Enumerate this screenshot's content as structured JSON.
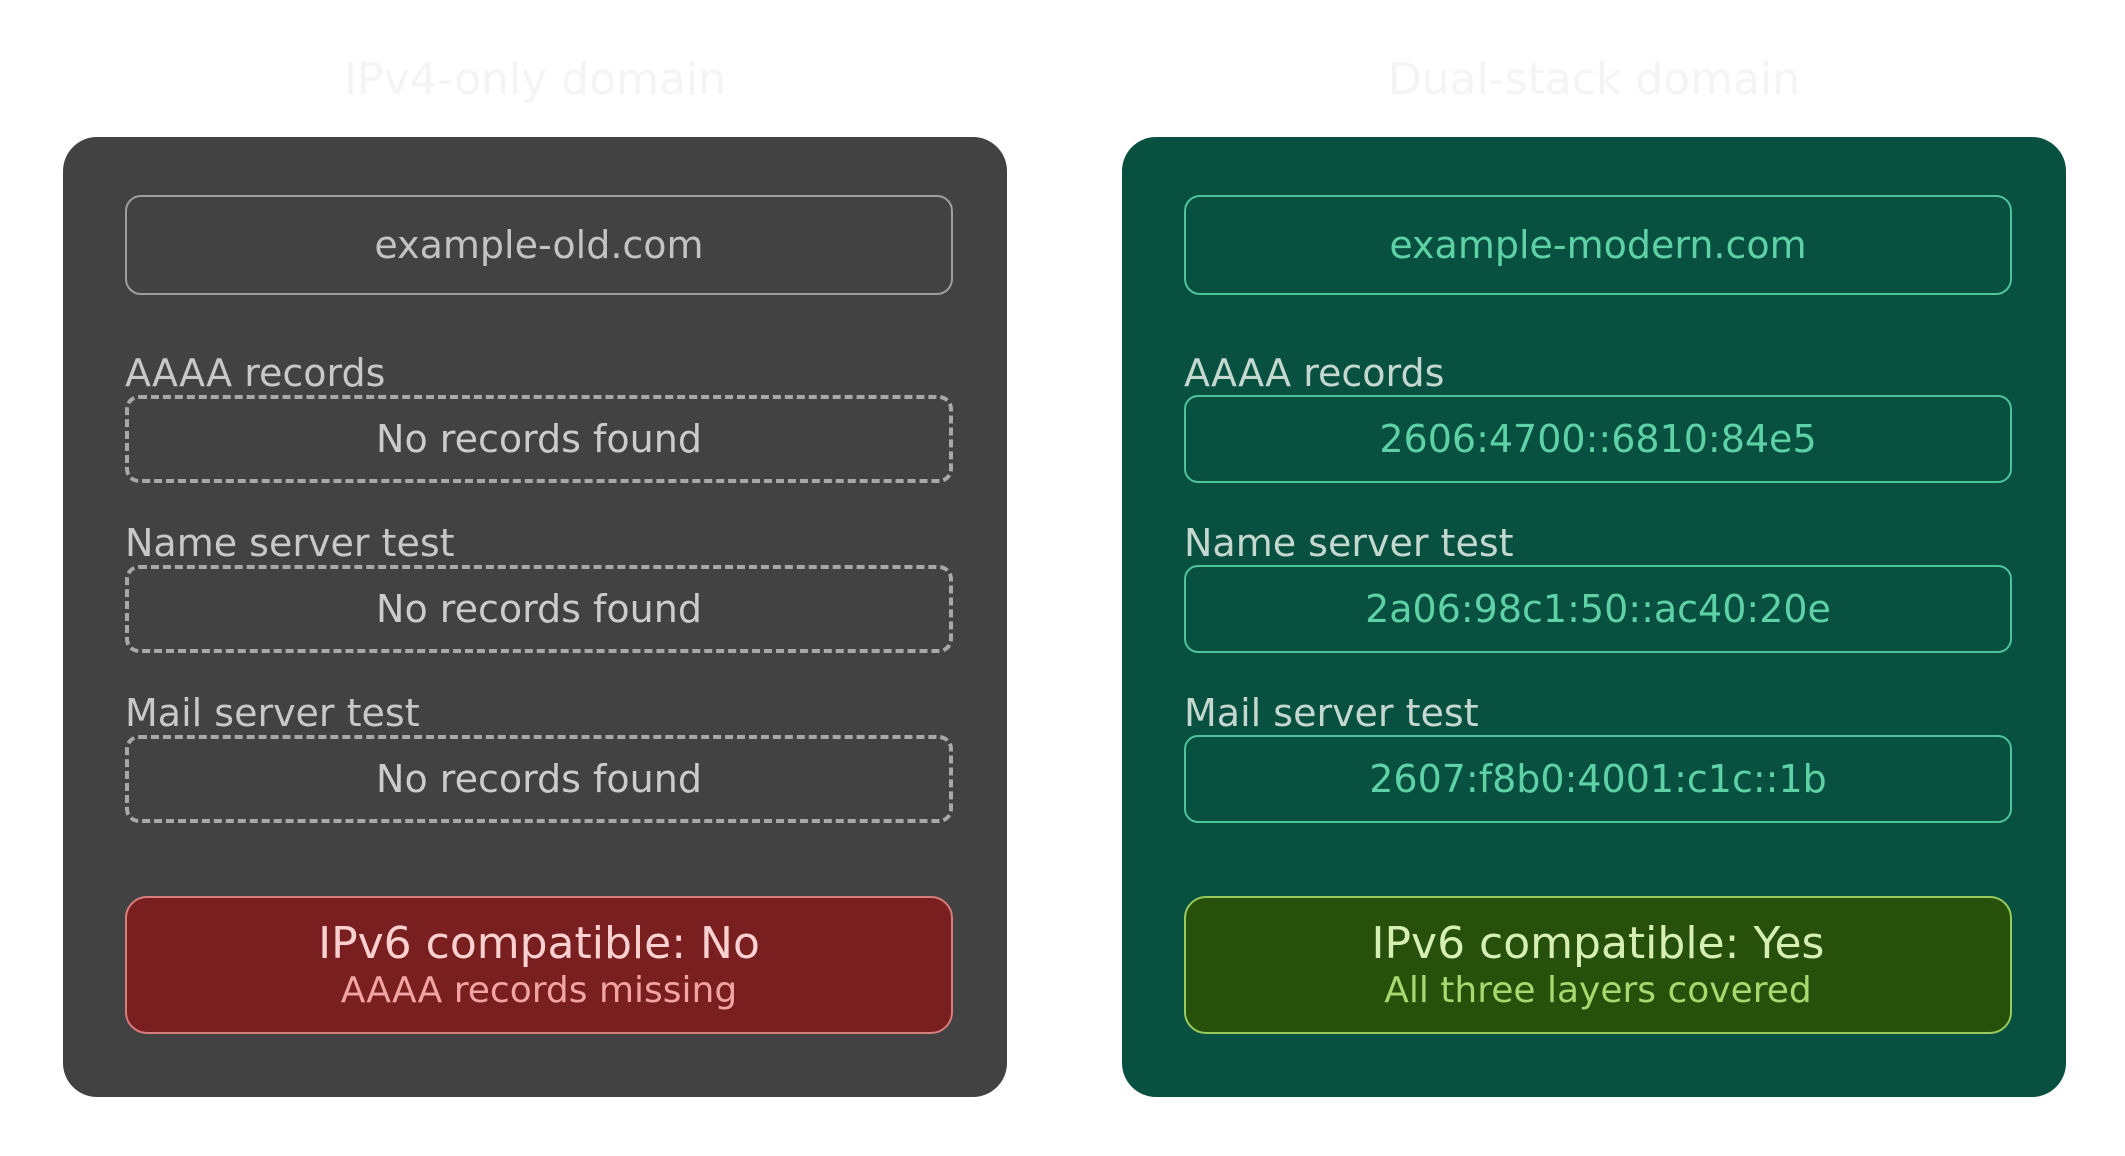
{
  "colors": {
    "left_panel": "#424242",
    "right_panel": "#08503f",
    "fail_bg": "#791f1f",
    "pass_bg": "#27500a",
    "accent_teal": "#5ed2a6"
  },
  "panels": [
    {
      "title": "IPv4-only domain",
      "domain": "example-old.com",
      "rows": [
        {
          "label": "AAAA records",
          "value": "No records found"
        },
        {
          "label": "Name server test",
          "value": "No records found"
        },
        {
          "label": "Mail server test",
          "value": "No records found"
        }
      ],
      "verdict": {
        "title": "IPv6 compatible: No",
        "subtitle": "AAAA records missing"
      }
    },
    {
      "title": "Dual-stack domain",
      "domain": "example-modern.com",
      "rows": [
        {
          "label": "AAAA records",
          "value": "2606:4700::6810:84e5"
        },
        {
          "label": "Name server test",
          "value": "2a06:98c1:50::ac40:20e"
        },
        {
          "label": "Mail server test",
          "value": "2607:f8b0:4001:c1c::1b"
        }
      ],
      "verdict": {
        "title": "IPv6 compatible: Yes",
        "subtitle": "All three layers covered"
      }
    }
  ]
}
